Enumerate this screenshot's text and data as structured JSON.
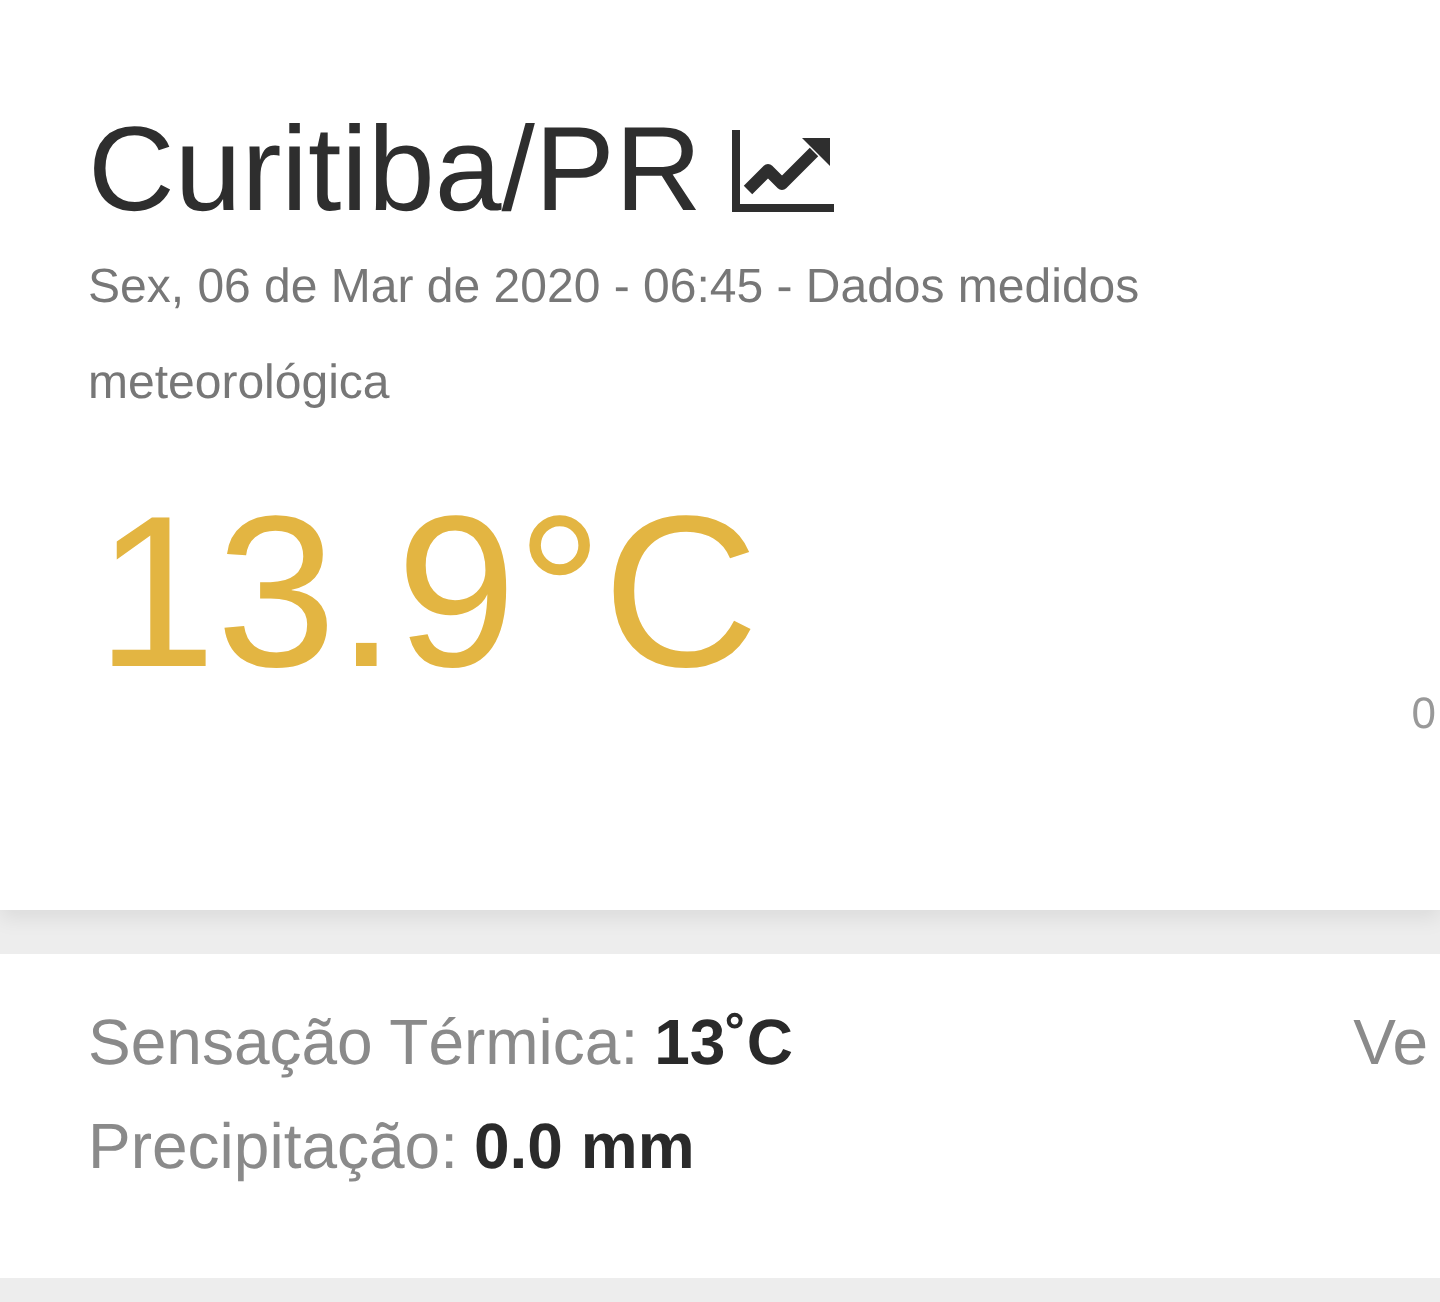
{
  "header": {
    "city": "Curitiba/PR",
    "subtitle_lines": [
      "Sex, 06 de Mar de 2020 - 06:45 - Dados medidos",
      "meteorológica"
    ]
  },
  "current": {
    "temperature": "13.9°C",
    "side_reading": "0"
  },
  "details": {
    "rows": [
      {
        "label": "Sensação Térmica:",
        "value": "13˚C",
        "side_label": "Ve"
      },
      {
        "label": "Precipitação:",
        "value": "0.0 mm"
      }
    ]
  }
}
